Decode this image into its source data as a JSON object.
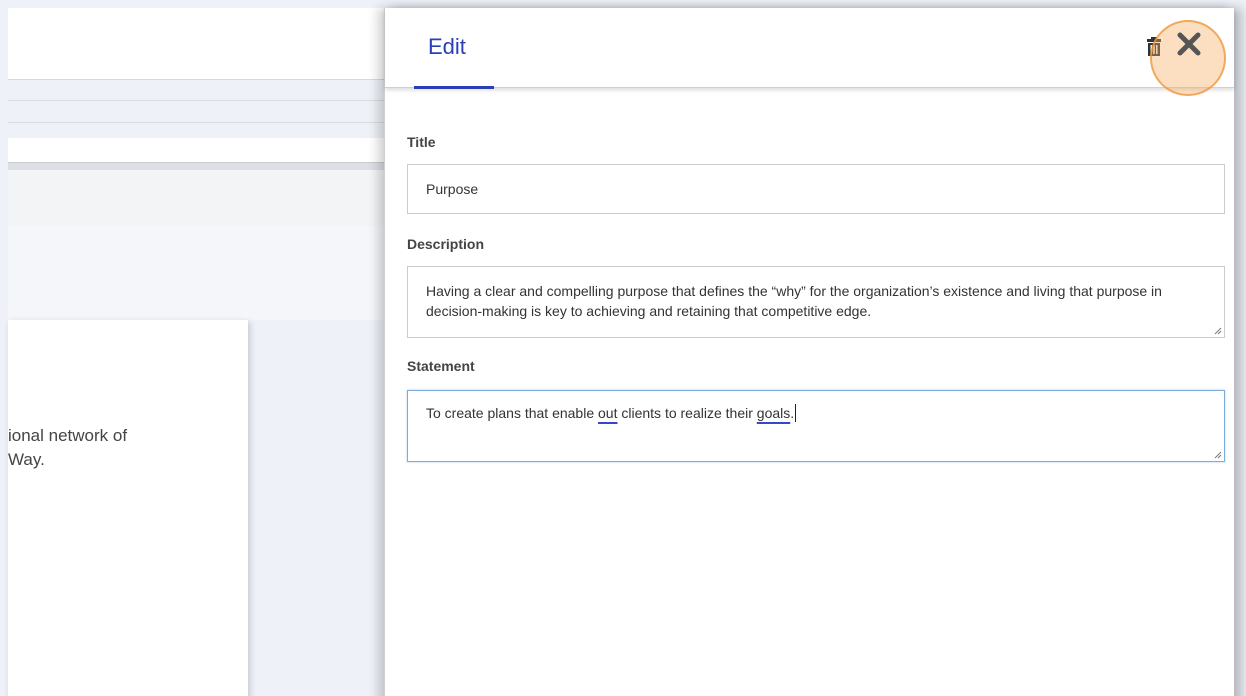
{
  "background": {
    "card_text_lines": [
      "ional network of",
      "Way."
    ]
  },
  "panel": {
    "tab_label": "Edit",
    "icons": {
      "delete": "trash-icon",
      "close": "close-icon"
    },
    "fields": {
      "title": {
        "label": "Title",
        "value": "Purpose"
      },
      "description": {
        "label": "Description",
        "value": "Having a clear and compelling purpose that defines the “why” for the organization’s existence and living that purpose in decision-making is key to achieving and retaining that competitive edge."
      },
      "statement": {
        "label": "Statement",
        "part1": "To create plans that enable ",
        "misspelled1": "out",
        "part2": " clients to realize their ",
        "misspelled2": "goals",
        "part3": "."
      }
    }
  },
  "colors": {
    "accent": "#2a3fb8",
    "close_highlight": "#f5aa5a",
    "focus_border": "#7aaedc"
  }
}
